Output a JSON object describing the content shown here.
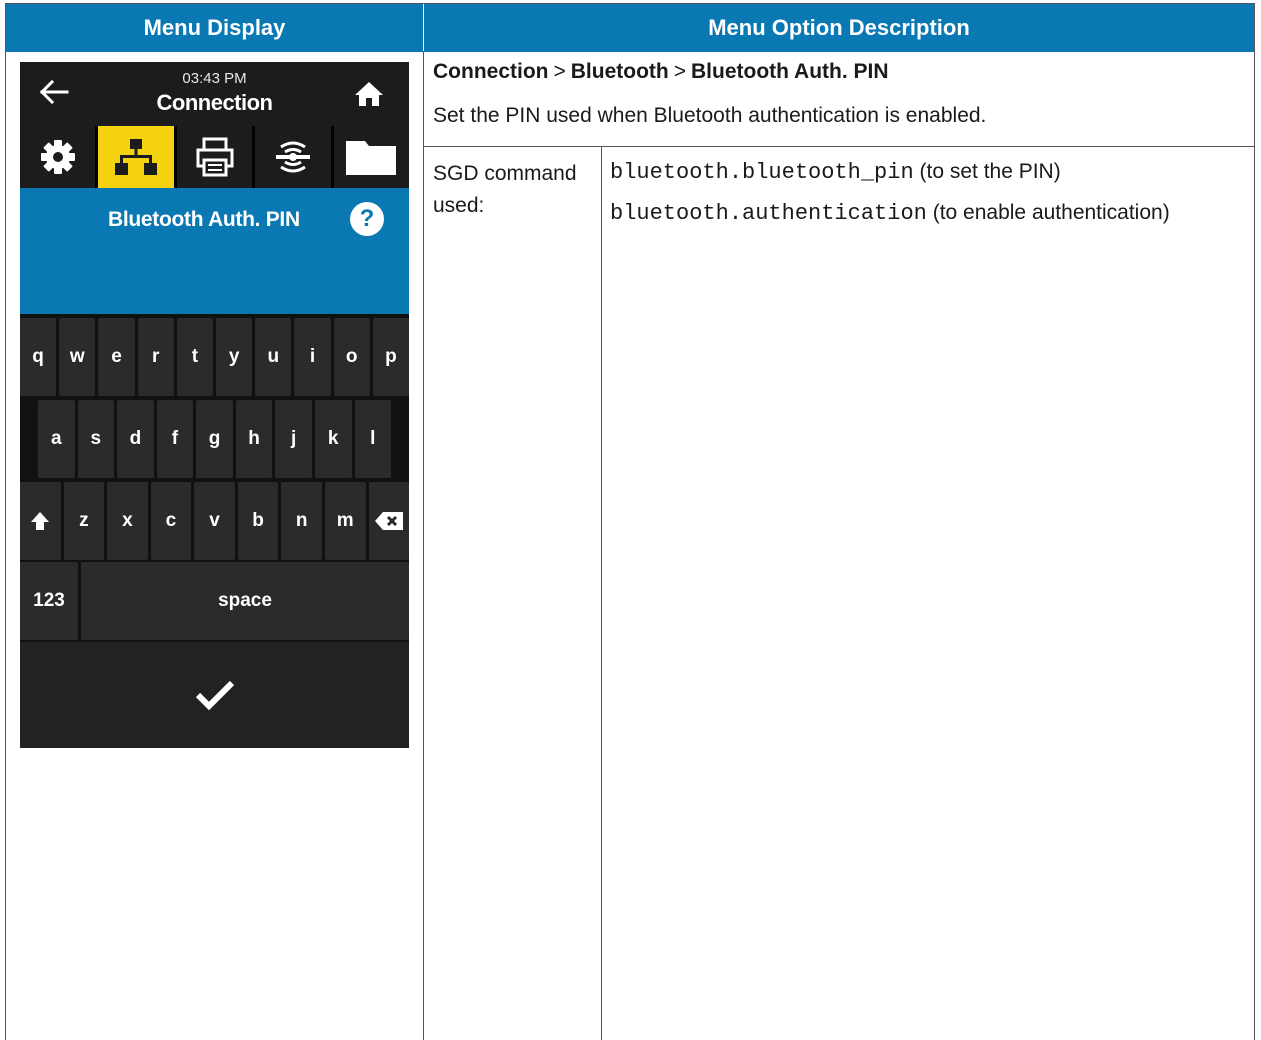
{
  "header": {
    "left": "Menu Display",
    "right": "Menu Option Description"
  },
  "breadcrumb": {
    "item1": "Connection",
    "item2": "Bluetooth",
    "item3": "Bluetooth Auth. PIN",
    "separator": ">"
  },
  "description": "Set the PIN used when Bluetooth authentication is enabled.",
  "sgd": {
    "label": "SGD command used:",
    "commands": [
      {
        "code": "bluetooth.bluetooth_pin",
        "note": "(to set the PIN)"
      },
      {
        "code": "bluetooth.authentication",
        "note": "(to enable authentication)"
      }
    ]
  },
  "device": {
    "time": "03:43 PM",
    "title": "Connection",
    "tabs": [
      "settings-icon",
      "network-icon",
      "printer-icon",
      "sensor-icon",
      "folder-icon"
    ],
    "active_tab": 1,
    "screen_title": "Bluetooth Auth. PIN",
    "help": "?",
    "keyboard": {
      "row1": [
        "q",
        "w",
        "e",
        "r",
        "t",
        "y",
        "u",
        "i",
        "o",
        "p"
      ],
      "row2": [
        "a",
        "s",
        "d",
        "f",
        "g",
        "h",
        "j",
        "k",
        "l"
      ],
      "row3": [
        "z",
        "x",
        "c",
        "v",
        "b",
        "n",
        "m"
      ],
      "numbers_key": "123",
      "space_key": "space"
    },
    "colors": {
      "accent_blue": "#0a78b3",
      "active_yellow": "#f5d20f",
      "dark": "#1c1c1c"
    }
  }
}
